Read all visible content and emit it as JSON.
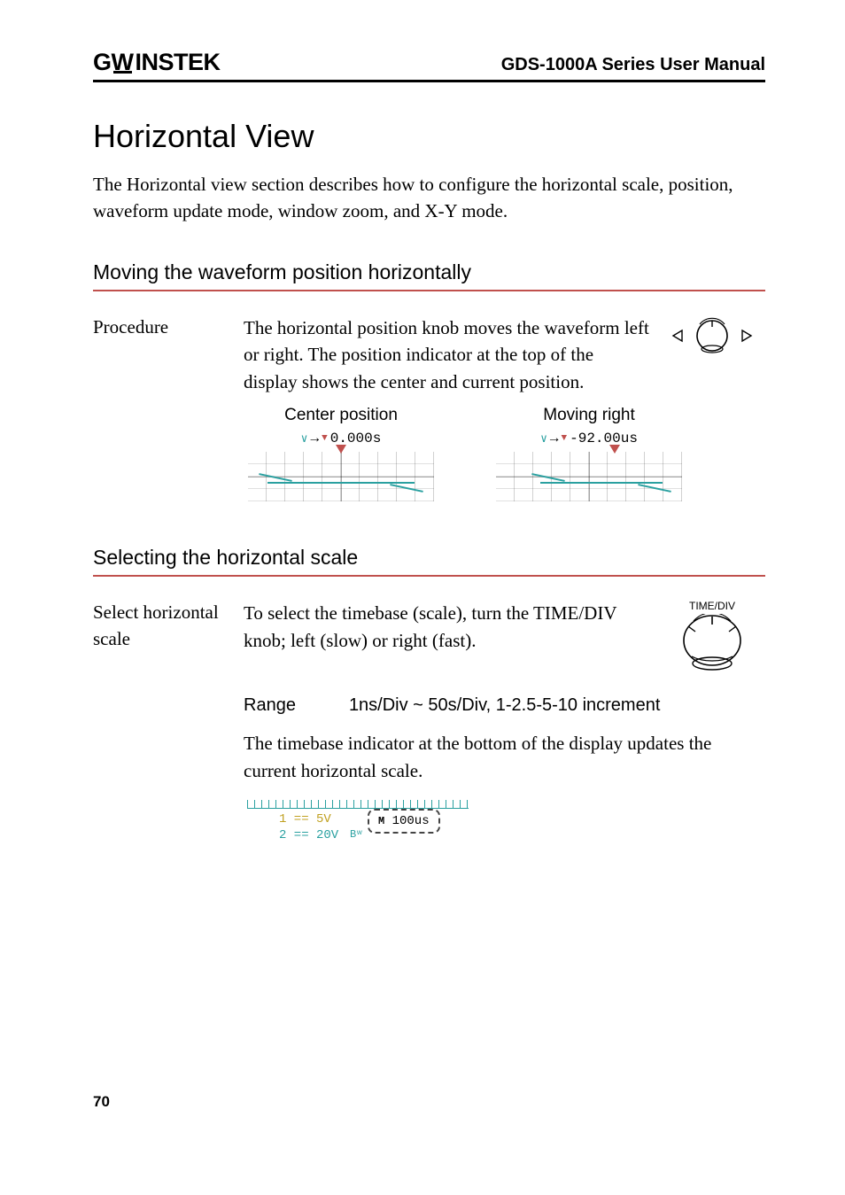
{
  "header": {
    "brand_g": "G",
    "brand_u": "W",
    "brand_rest": "INSTEK",
    "title": "GDS-1000A Series User Manual"
  },
  "section": {
    "title": "Horizontal View",
    "intro": "The Horizontal view section describes how to configure the horizontal scale, position, waveform update mode, window zoom, and X-Y mode."
  },
  "sub1": {
    "heading": "Moving the waveform position horizontally",
    "label": "Procedure",
    "text": "The horizontal position knob moves the waveform left or right. The position indicator at the top of the display shows the center and current position.",
    "example_center_cap": "Center position",
    "example_right_cap": "Moving right",
    "readout_center": "0.000s",
    "readout_right": "-92.00us"
  },
  "sub2": {
    "heading": "Selecting the horizontal scale",
    "label": "Select horizontal scale",
    "text": "To select the timebase (scale), turn the TIME/DIV knob; left (slow) or right (fast).",
    "knob_label": "TIME/DIV",
    "range_label": "Range",
    "range_value": "1ns/Div ~ 50s/Div, 1-2.5-5-10 increment",
    "note": "The timebase indicator at the bottom of the display updates the current horizontal scale.",
    "tb_ch1": "1 == 5V",
    "tb_ch2": "2 == 20V",
    "tb_bw": "Bʷ",
    "tb_callout_m": "M",
    "tb_callout_val": " 100us"
  },
  "page_number": "70"
}
